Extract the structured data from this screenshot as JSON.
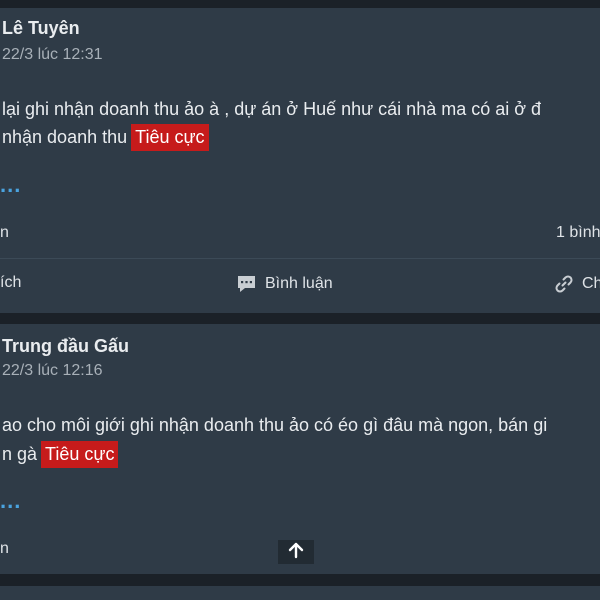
{
  "posts": [
    {
      "author": "Lê Tuyên",
      "time": "22/3 lúc 12:31",
      "line1": "lại ghi nhận doanh thu ảo à , dự án ở Huế như cái nhà ma có ai ở đ",
      "line2": "nhận doanh thu",
      "tag": "Tiêu cực",
      "more": "...",
      "meta_left": "n",
      "meta_right": "1 bình",
      "action_like": "ích",
      "action_comment": "Bình luận",
      "action_share": "Ch"
    },
    {
      "author": "Trung đầu Gấu",
      "time": "22/3 lúc 12:16",
      "line1": "ao cho môi giới ghi nhận doanh thu ảo có éo gì đâu mà ngon, bán gi",
      "line2": "n gà",
      "tag": "Tiêu cực",
      "more": "...",
      "meta_left": "n"
    }
  ],
  "icons": {
    "comment": "speech-bubble-icon",
    "share": "link-icon",
    "scroll_top": "arrow-up-icon"
  },
  "colors": {
    "card_bg": "#2f3b47",
    "page_bg": "#1b2128",
    "tag_bg": "#c61b1b",
    "more_link": "#4aa3df"
  }
}
